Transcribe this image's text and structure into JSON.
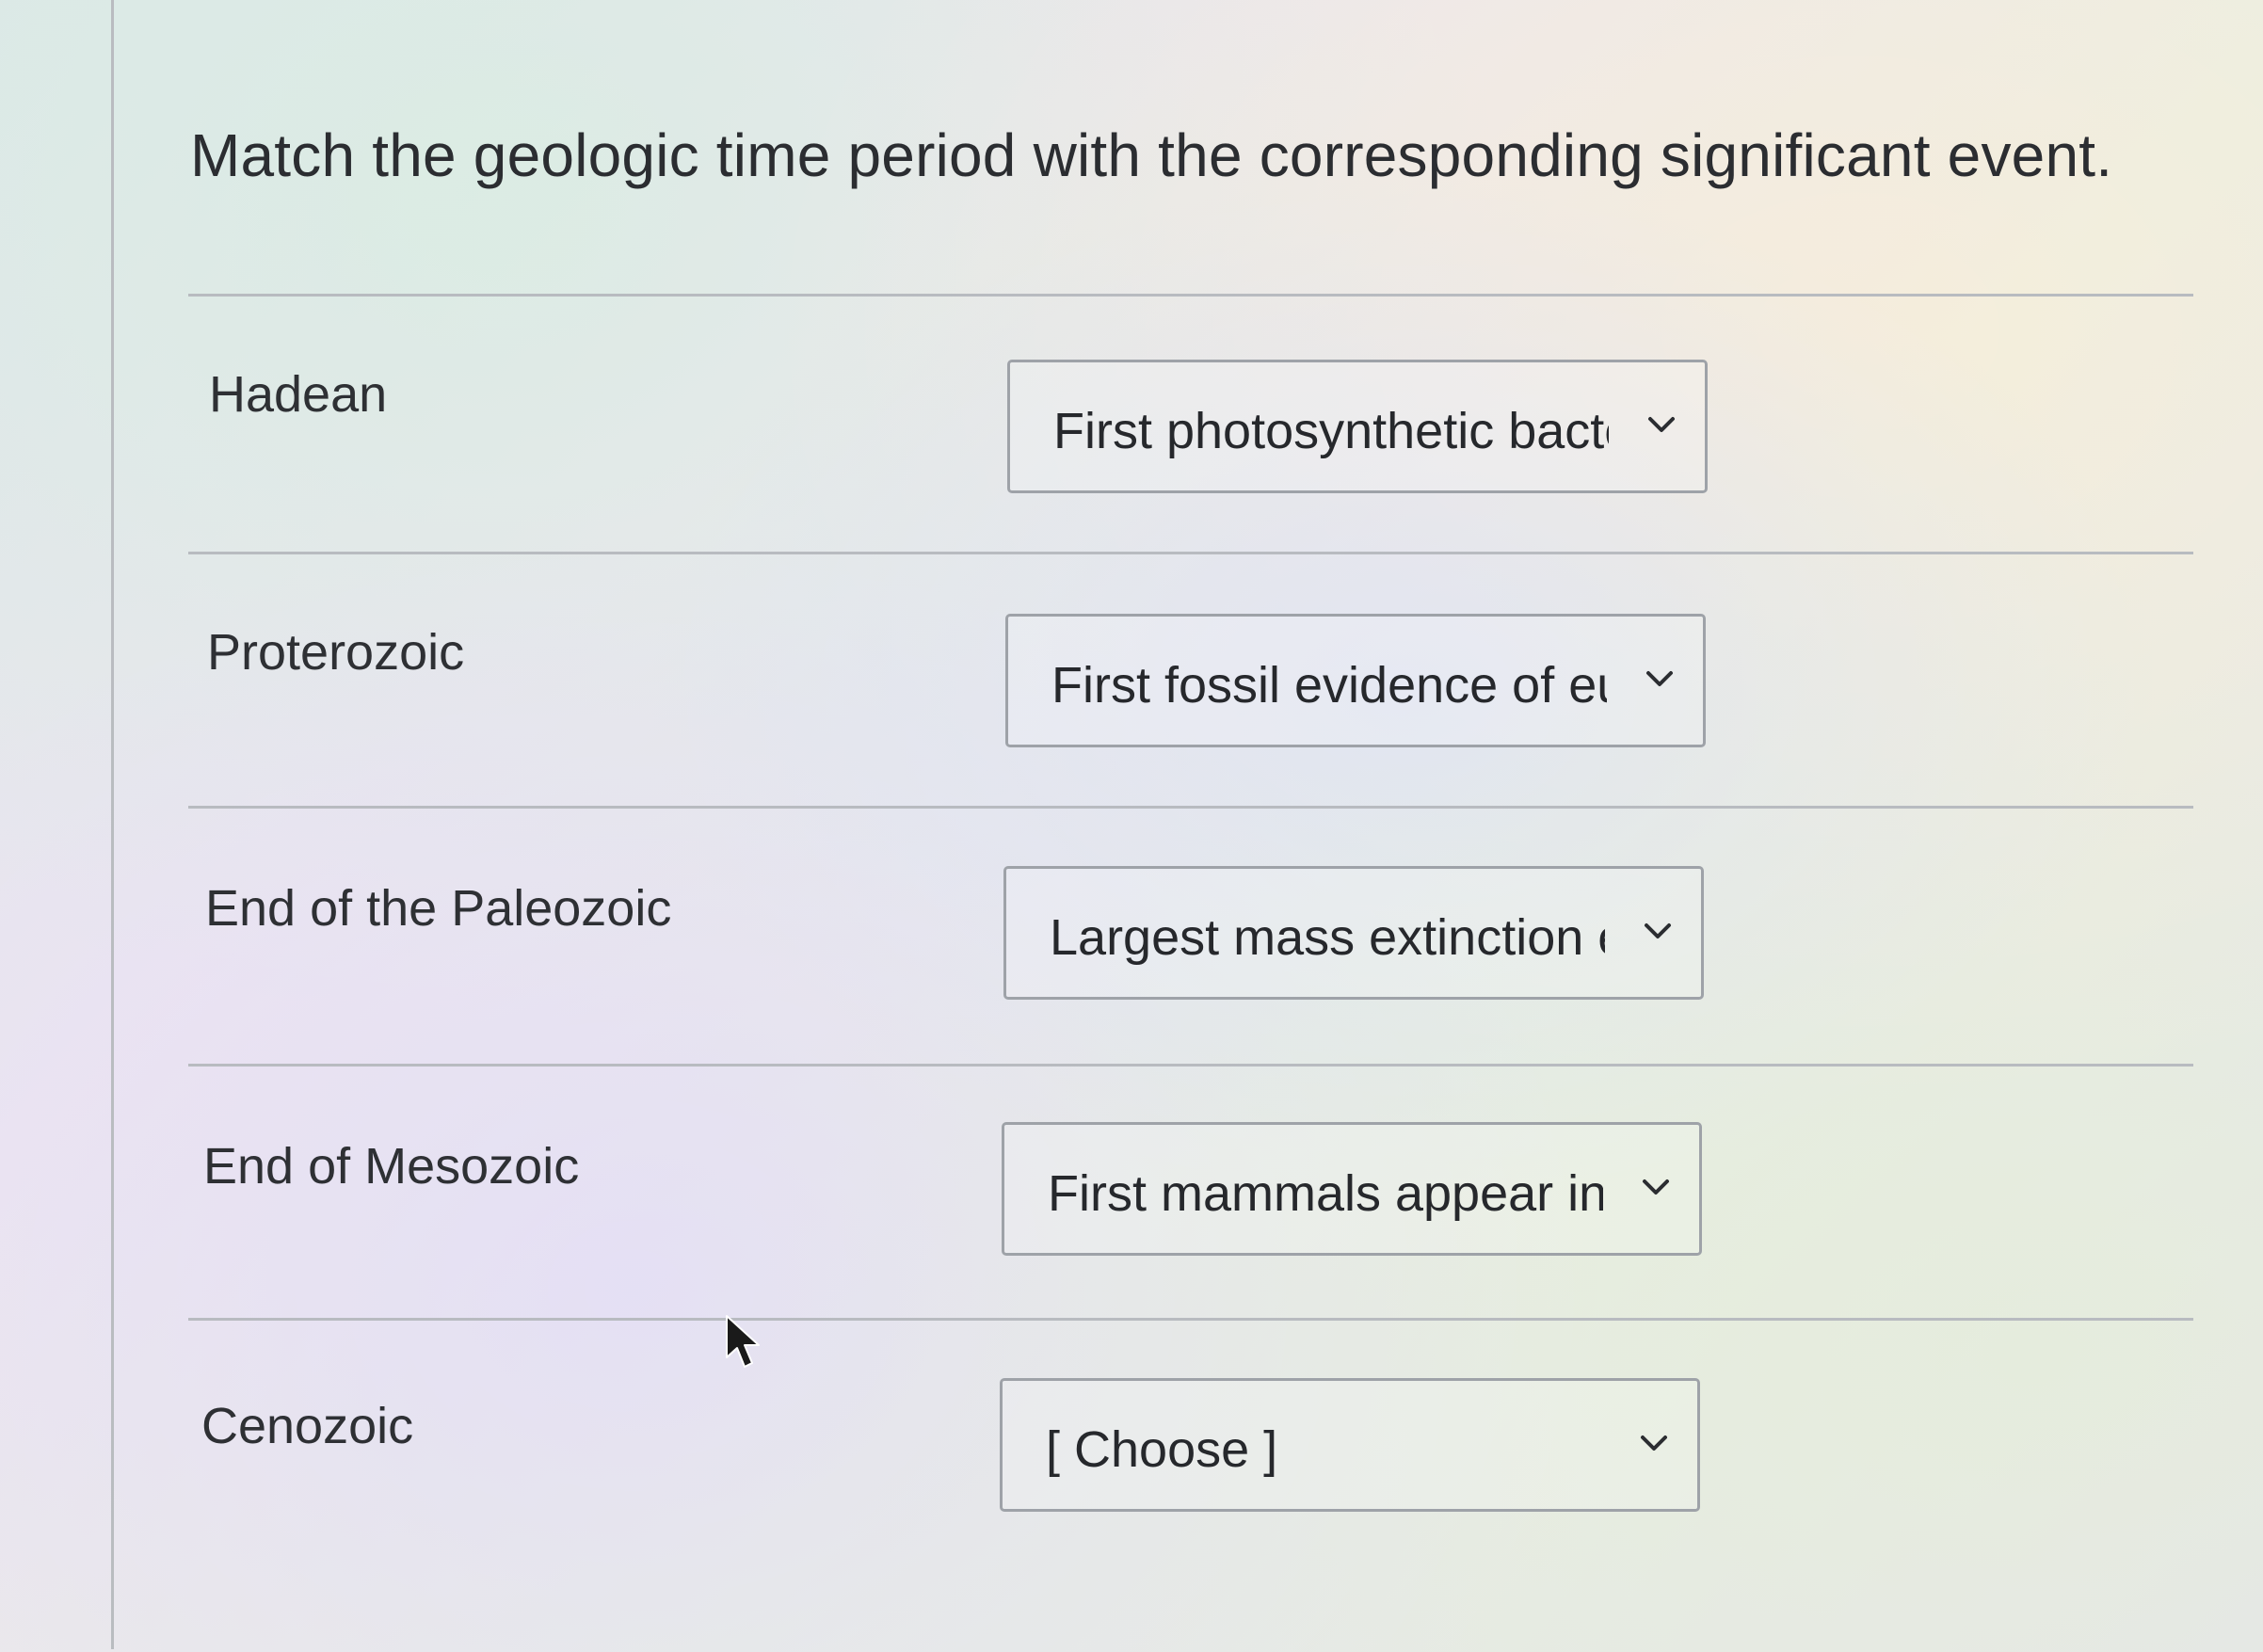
{
  "question": "Match the geologic time period with the corresponding significant event.",
  "rows": [
    {
      "label": "Hadean",
      "selected": "First photosynthetic bacte"
    },
    {
      "label": "Proterozoic",
      "selected": "First fossil evidence of eul"
    },
    {
      "label": "End of the Paleozoic",
      "selected": "Largest mass extinction e'"
    },
    {
      "label": "End of Mesozoic",
      "selected": "First mammals appear in t"
    },
    {
      "label": "Cenozoic",
      "selected": "[ Choose ]"
    }
  ],
  "icons": {
    "dropdown": "chevron-down-icon",
    "cursor": "mouse-pointer-icon"
  },
  "colors": {
    "text": "#2b2d31",
    "border": "#9ea2a8",
    "divider": "#b8bbc0"
  }
}
